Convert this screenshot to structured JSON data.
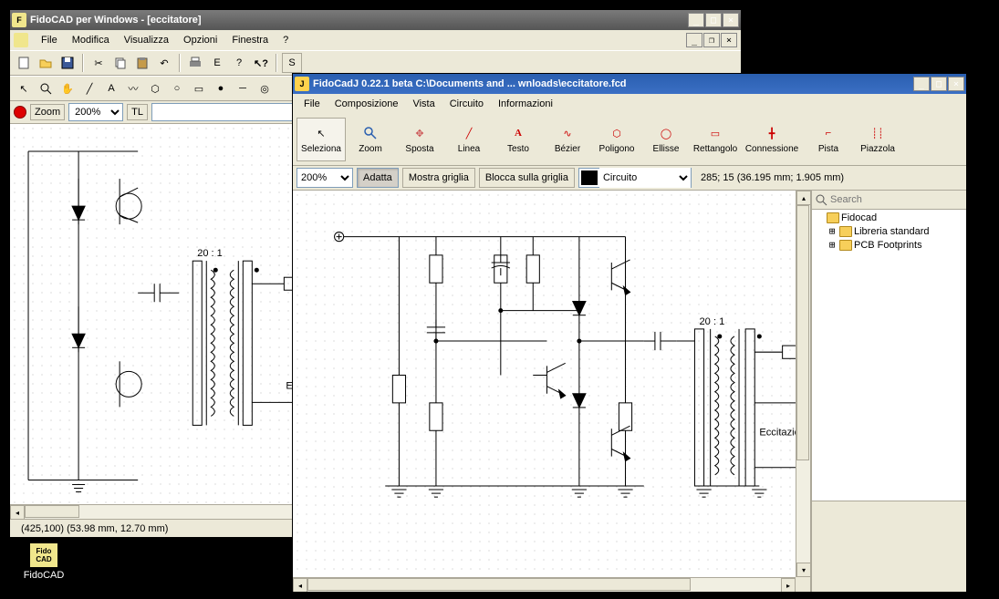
{
  "win1": {
    "title": "FidoCAD per Windows - [eccitatore]",
    "menu": [
      "File",
      "Modifica",
      "Visualizza",
      "Opzioni",
      "Finestra",
      "?"
    ],
    "zoom_label": "Zoom",
    "zoom_value": "200%",
    "tl_label": "TL",
    "status": "(425,100) (53.98 mm, 12.70 mm)"
  },
  "win2": {
    "title": "FidoCadJ 0.22.1 beta C:\\Documents and ...  wnloads\\eccitatore.fcd",
    "menu": [
      "File",
      "Composizione",
      "Vista",
      "Circuito",
      "Informazioni"
    ],
    "tools": [
      {
        "label": "Seleziona"
      },
      {
        "label": "Zoom"
      },
      {
        "label": "Sposta"
      },
      {
        "label": "Linea"
      },
      {
        "label": "Testo"
      },
      {
        "label": "Bézier"
      },
      {
        "label": "Poligono"
      },
      {
        "label": "Ellisse"
      },
      {
        "label": "Rettangolo"
      },
      {
        "label": "Connessione"
      },
      {
        "label": "Pista"
      },
      {
        "label": "Piazzola"
      }
    ],
    "zoom_value": "200%",
    "adatta": "Adatta",
    "mostra": "Mostra griglia",
    "blocca": "Blocca sulla griglia",
    "layer": "Circuito",
    "coords": "285; 15 (36.195 mm; 1.905 mm)",
    "search_placeholder": "Search",
    "tree": {
      "root": "Fidocad",
      "child1": "Libreria standard",
      "child2": "PCB Footprints"
    },
    "schematic_label_ratio": "20 : 1",
    "schematic_label_eccit": "Eccitazio"
  },
  "win1_schematic": {
    "ratio": "20 : 1",
    "eccit": "Ecc"
  },
  "desktop": {
    "fidocad": "FidoCAD"
  }
}
